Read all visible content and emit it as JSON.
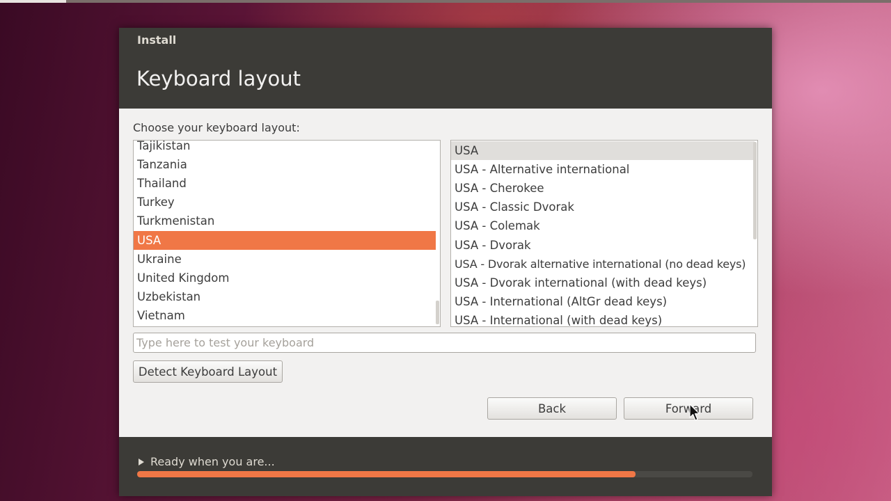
{
  "window": {
    "title": "Install",
    "page_title": "Keyboard layout"
  },
  "layout": {
    "prompt": "Choose your keyboard layout:",
    "countries": [
      "Tajikistan",
      "Tanzania",
      "Thailand",
      "Turkey",
      "Turkmenistan",
      "USA",
      "Ukraine",
      "United Kingdom",
      "Uzbekistan",
      "Vietnam"
    ],
    "selected_country": "USA",
    "variants": [
      "USA",
      "USA - Alternative international",
      "USA - Cherokee",
      "USA - Classic Dvorak",
      "USA - Colemak",
      "USA - Dvorak",
      "USA - Dvorak alternative international (no dead keys)",
      "USA - Dvorak international (with dead keys)",
      "USA - International (AltGr dead keys)",
      "USA - International (with dead keys)"
    ],
    "selected_variant": "USA",
    "test_placeholder": "Type here to test your keyboard",
    "test_value": "",
    "detect_label": "Detect Keyboard Layout"
  },
  "nav": {
    "back_label": "Back",
    "forward_label": "Forward"
  },
  "footer": {
    "status": "Ready when you are...",
    "progress_percent": 81
  },
  "colors": {
    "accent": "#f07746",
    "header_bg": "#3c3b37",
    "window_bg": "#f2f1f0"
  },
  "icons": {
    "expander": "triangle-right-icon",
    "cursor": "mouse-pointer-icon"
  }
}
